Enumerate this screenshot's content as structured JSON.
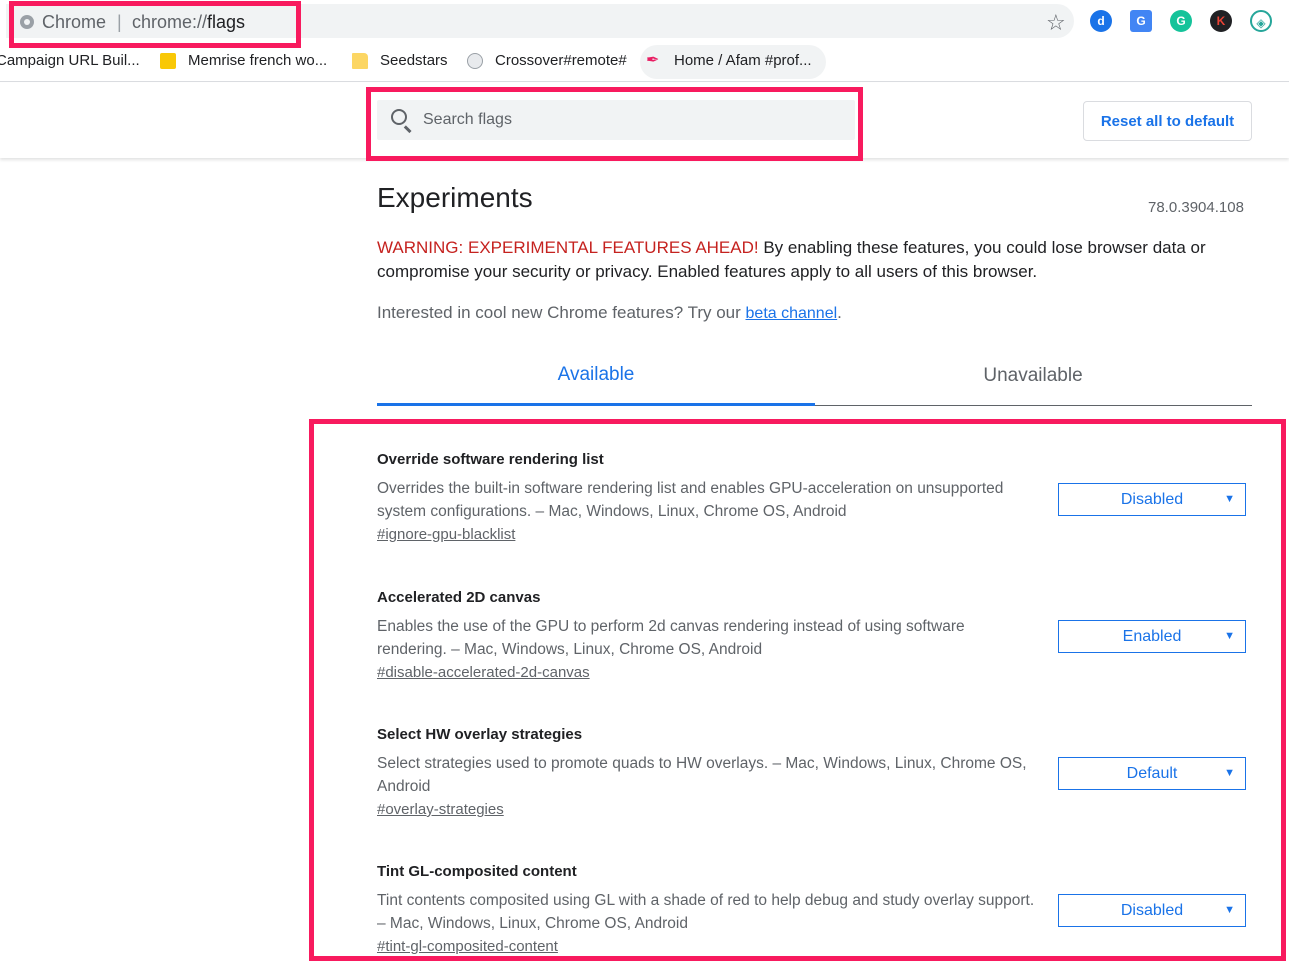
{
  "omnibox": {
    "site_name": "Chrome",
    "separator": "|",
    "url_scheme": "chrome://",
    "url_path": "flags"
  },
  "extensions": [
    {
      "icon": "dashlane-icon",
      "glyph": "d"
    },
    {
      "icon": "google-translate-icon",
      "glyph": "G"
    },
    {
      "icon": "grammarly-icon",
      "glyph": "G"
    },
    {
      "icon": "kami-icon",
      "glyph": "K"
    },
    {
      "icon": "shield-extension-icon",
      "glyph": "◈"
    }
  ],
  "bookmarks": [
    {
      "label": "Campaign URL Buil...",
      "icon": "none"
    },
    {
      "label": "Memrise french wo...",
      "icon": "memrise-icon"
    },
    {
      "label": "Seedstars",
      "icon": "folder-icon"
    },
    {
      "label": "Crossover#remote#",
      "icon": "crossover-icon"
    },
    {
      "label": "Home / Afam #prof...",
      "icon": "feather-icon"
    }
  ],
  "search": {
    "placeholder": "Search flags",
    "value": ""
  },
  "reset_label": "Reset all to default",
  "title": "Experiments",
  "version": "78.0.3904.108",
  "warning": {
    "label": "WARNING: EXPERIMENTAL FEATURES AHEAD!",
    "text": " By enabling these features, you could lose browser data or compromise your security or privacy. Enabled features apply to all users of this browser."
  },
  "interest": {
    "text": "Interested in cool new Chrome features? Try our ",
    "link": "beta channel",
    "suffix": "."
  },
  "tabs": {
    "available": "Available",
    "unavailable": "Unavailable",
    "active": "available"
  },
  "experiments": [
    {
      "name": "Override software rendering list",
      "description": "Overrides the built-in software rendering list and enables GPU-acceleration on unsupported system configurations. – Mac, Windows, Linux, Chrome OS, Android",
      "link": "#ignore-gpu-blacklist",
      "value": "Disabled"
    },
    {
      "name": "Accelerated 2D canvas",
      "description": "Enables the use of the GPU to perform 2d canvas rendering instead of using software rendering. – Mac, Windows, Linux, Chrome OS, Android",
      "link": "#disable-accelerated-2d-canvas",
      "value": "Enabled"
    },
    {
      "name": "Select HW overlay strategies",
      "description": "Select strategies used to promote quads to HW overlays. – Mac, Windows, Linux, Chrome OS, Android",
      "link": "#overlay-strategies",
      "value": "Default"
    },
    {
      "name": "Tint GL-composited content",
      "description": "Tint contents composited using GL with a shade of red to help debug and study overlay support. – Mac, Windows, Linux, Chrome OS, Android",
      "link": "#tint-gl-composited-content",
      "value": "Disabled"
    }
  ],
  "colors": {
    "accent": "#1a73e8",
    "warning": "#c5221f",
    "highlight": "#f81a5e"
  }
}
